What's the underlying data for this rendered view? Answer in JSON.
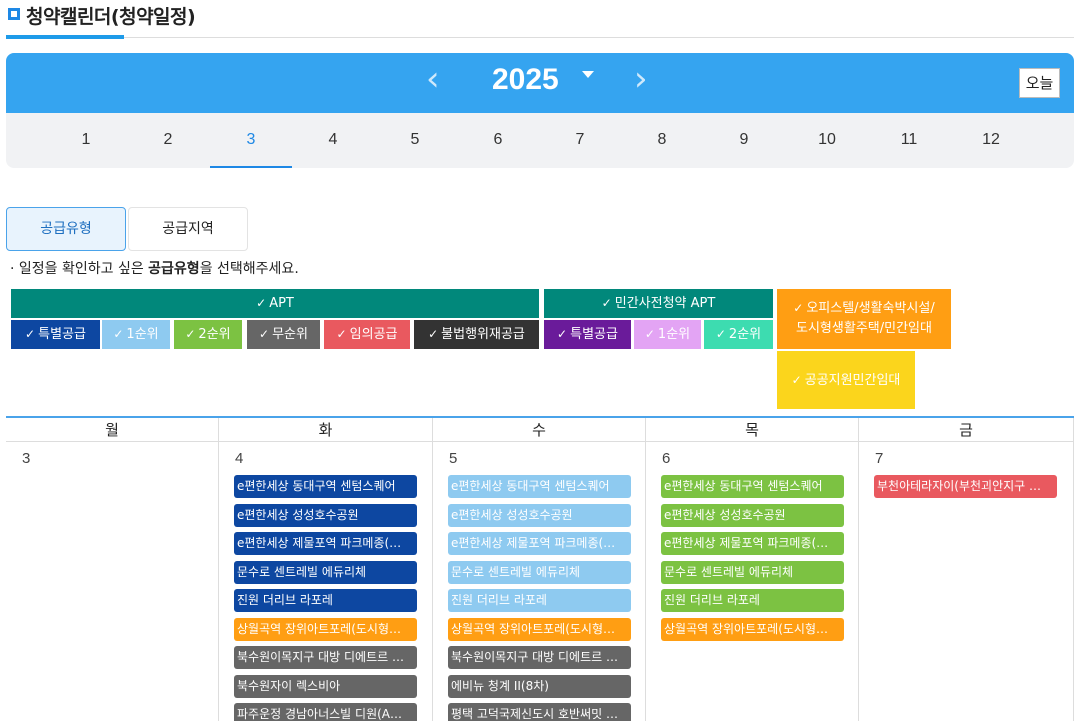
{
  "page_title": "청약캘린더(청약일정)",
  "header": {
    "year": "2025",
    "prev_icon": "chevron-left-icon",
    "next_icon": "chevron-right-icon",
    "today_label": "오늘"
  },
  "months": [
    "1",
    "2",
    "3",
    "4",
    "5",
    "6",
    "7",
    "8",
    "9",
    "10",
    "11",
    "12"
  ],
  "active_month": "3",
  "tabs": [
    {
      "label": "공급유형",
      "active": true
    },
    {
      "label": "공급지역",
      "active": false
    }
  ],
  "hint": {
    "prefix": "· 일정을 확인하고 싶은 ",
    "bold": "공급유형",
    "suffix": "을 선택해주세요."
  },
  "filters": {
    "check_glyph": "✓",
    "apt": {
      "label": "APT",
      "color": "#01887b"
    },
    "apt_items": [
      {
        "label": "특별공급",
        "color": "#0d47a1"
      },
      {
        "label": "1순위",
        "color": "#8ecaf0"
      },
      {
        "label": "2순위",
        "color": "#7cc242"
      },
      {
        "label": "무순위",
        "color": "#666666"
      },
      {
        "label": "임의공급",
        "color": "#e9595f"
      },
      {
        "label": "불법행위재공급",
        "color": "#333333"
      }
    ],
    "presale": {
      "label": "민간사전청약 APT",
      "color": "#01887b"
    },
    "presale_items": [
      {
        "label": "특별공급",
        "color": "#6a1b9a"
      },
      {
        "label": "1순위",
        "color": "#e3a4f4"
      },
      {
        "label": "2순위",
        "color": "#3ddcb0"
      }
    ],
    "officetel": {
      "line1": "오피스텔/생활숙박시설/",
      "line2": "도시형생활주택/민간임대",
      "color": "#ff9e13"
    },
    "public_rental": {
      "label": "공공지원민간임대",
      "color": "#fbd51c"
    }
  },
  "calendar": {
    "days": [
      {
        "weekday": "월",
        "date": "3",
        "events": []
      },
      {
        "weekday": "화",
        "date": "4",
        "events": [
          {
            "text": "e편한세상 동대구역 센텀스퀘어",
            "color": "#0d47a1"
          },
          {
            "text": "e편한세상 성성호수공원",
            "color": "#0d47a1"
          },
          {
            "text": "e편한세상 제물포역 파크메종(…",
            "color": "#0d47a1"
          },
          {
            "text": "문수로 센트레빌 에듀리체",
            "color": "#0d47a1"
          },
          {
            "text": "진원 더리브 라포레",
            "color": "#0d47a1"
          },
          {
            "text": "상월곡역 장위아트포레(도시형…",
            "color": "#ff9e13"
          },
          {
            "text": "북수원이목지구 대방 디에트르 …",
            "color": "#666666"
          },
          {
            "text": "북수원자이 렉스비아",
            "color": "#666666"
          },
          {
            "text": "파주운정 경남아너스빌 디원(A…",
            "color": "#666666"
          }
        ]
      },
      {
        "weekday": "수",
        "date": "5",
        "events": [
          {
            "text": "e편한세상 동대구역 센텀스퀘어",
            "color": "#8ecaf0"
          },
          {
            "text": "e편한세상 성성호수공원",
            "color": "#8ecaf0"
          },
          {
            "text": "e편한세상 제물포역 파크메종(…",
            "color": "#8ecaf0"
          },
          {
            "text": "문수로 센트레빌 에듀리체",
            "color": "#8ecaf0"
          },
          {
            "text": "진원 더리브 라포레",
            "color": "#8ecaf0"
          },
          {
            "text": "상월곡역 장위아트포레(도시형…",
            "color": "#ff9e13"
          },
          {
            "text": "북수원이목지구 대방 디에트르 …",
            "color": "#666666"
          },
          {
            "text": "에비뉴 청계 II(8차)",
            "color": "#666666"
          },
          {
            "text": "평택 고덕국제신도시 호반써밋 …",
            "color": "#666666"
          }
        ]
      },
      {
        "weekday": "목",
        "date": "6",
        "events": [
          {
            "text": "e편한세상 동대구역 센텀스퀘어",
            "color": "#7cc242"
          },
          {
            "text": "e편한세상 성성호수공원",
            "color": "#7cc242"
          },
          {
            "text": "e편한세상 제물포역 파크메종(…",
            "color": "#7cc242"
          },
          {
            "text": "문수로 센트레빌 에듀리체",
            "color": "#7cc242"
          },
          {
            "text": "진원 더리브 라포레",
            "color": "#7cc242"
          },
          {
            "text": "상월곡역 장위아트포레(도시형…",
            "color": "#ff9e13"
          }
        ]
      },
      {
        "weekday": "금",
        "date": "7",
        "events": [
          {
            "text": "부천아테라자이(부천괴안지구 …",
            "color": "#e9595f"
          }
        ]
      }
    ]
  }
}
